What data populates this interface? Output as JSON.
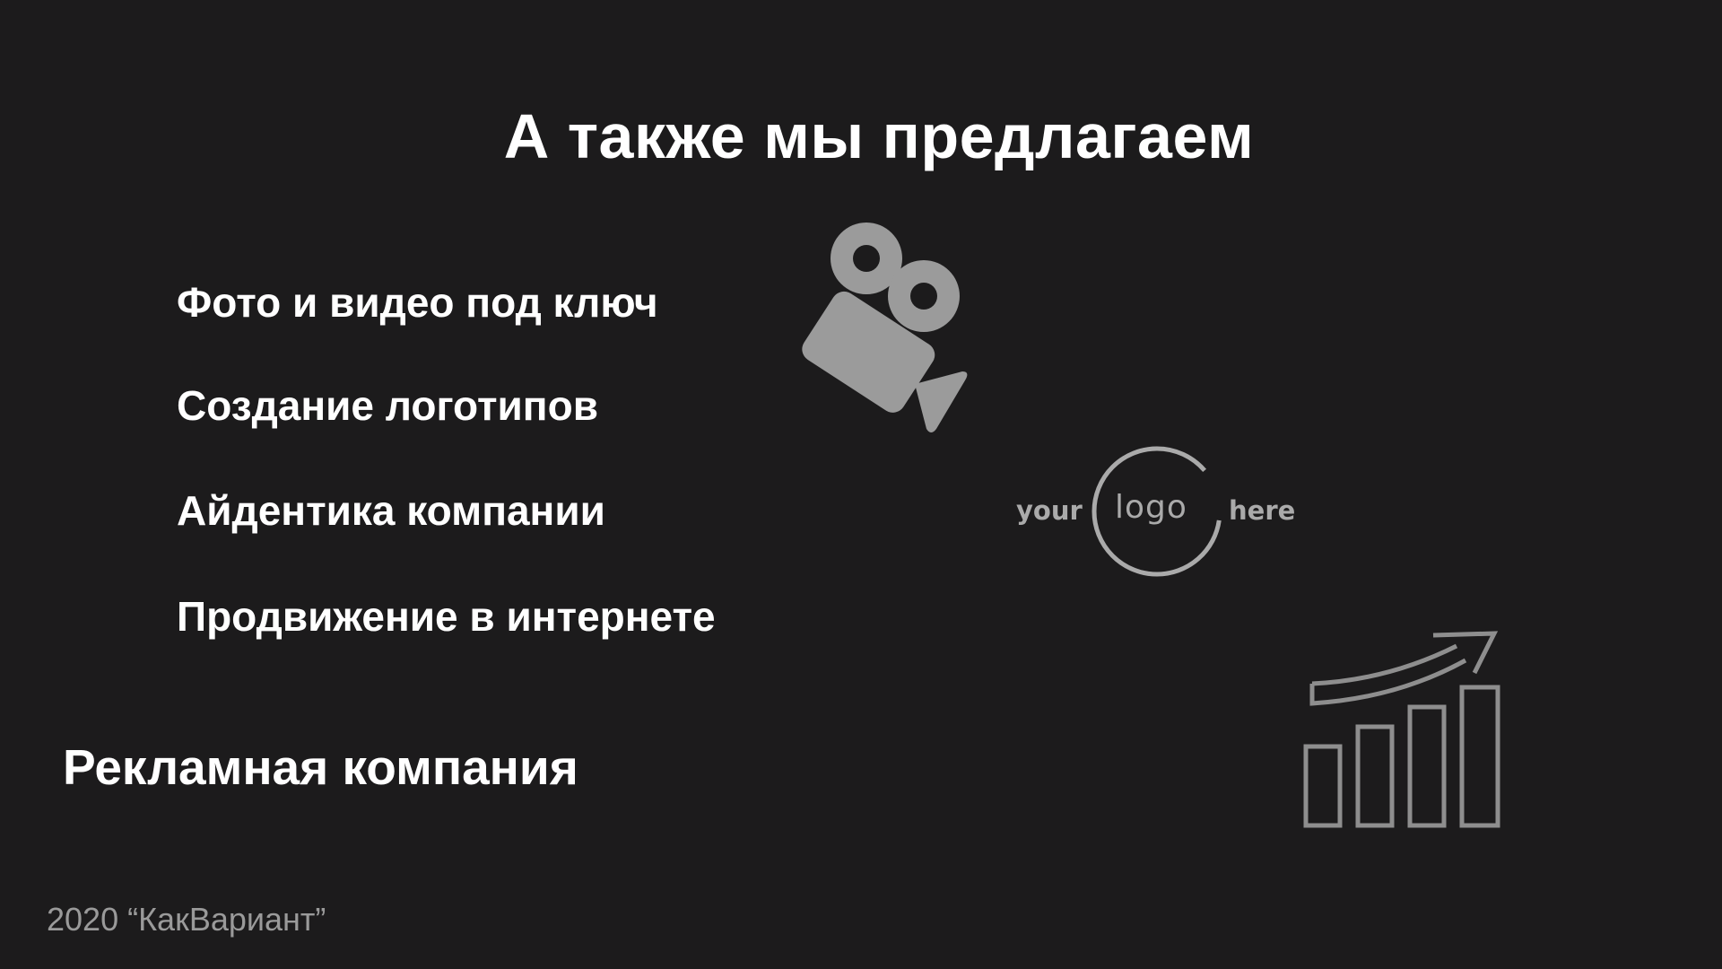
{
  "slide": {
    "title": "А также мы предлагаем",
    "services": [
      "Фото и видео под ключ",
      "Создание логотипов",
      "Айдентика компании",
      "Продвижение в интернете"
    ],
    "highlight": "Рекламная компания",
    "footer": "2020 “КакВариант”"
  },
  "illustrations": {
    "camera_icon": "video-camera-icon",
    "logo_placeholder": {
      "left_word": "your",
      "center_word": "logo",
      "right_word": "here"
    },
    "growth_icon": "growth-chart-icon"
  },
  "colors": {
    "background": "#1c1b1c",
    "text": "#ffffff",
    "icon": "#9b9b9b",
    "footer": "#9a9a9a"
  }
}
